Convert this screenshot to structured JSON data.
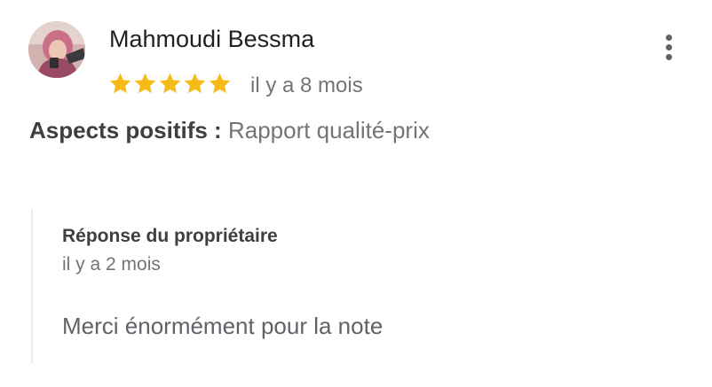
{
  "review": {
    "author": "Mahmoudi Bessma",
    "avatar": "profile-photo",
    "rating": 5,
    "rating_max": 5,
    "time": "il y a 8 mois",
    "aspects_label": "Aspects positifs :",
    "aspects_value": "Rapport qualité-prix",
    "more_icon": "more-vertical-icon"
  },
  "owner_reply": {
    "title": "Réponse du propriétaire",
    "time": "il y a 2 mois",
    "text": "Merci énormément pour la note"
  },
  "colors": {
    "star": "#f6bb18",
    "primary_text": "#202124",
    "secondary_text": "#70757a",
    "divider": "#ececec"
  }
}
